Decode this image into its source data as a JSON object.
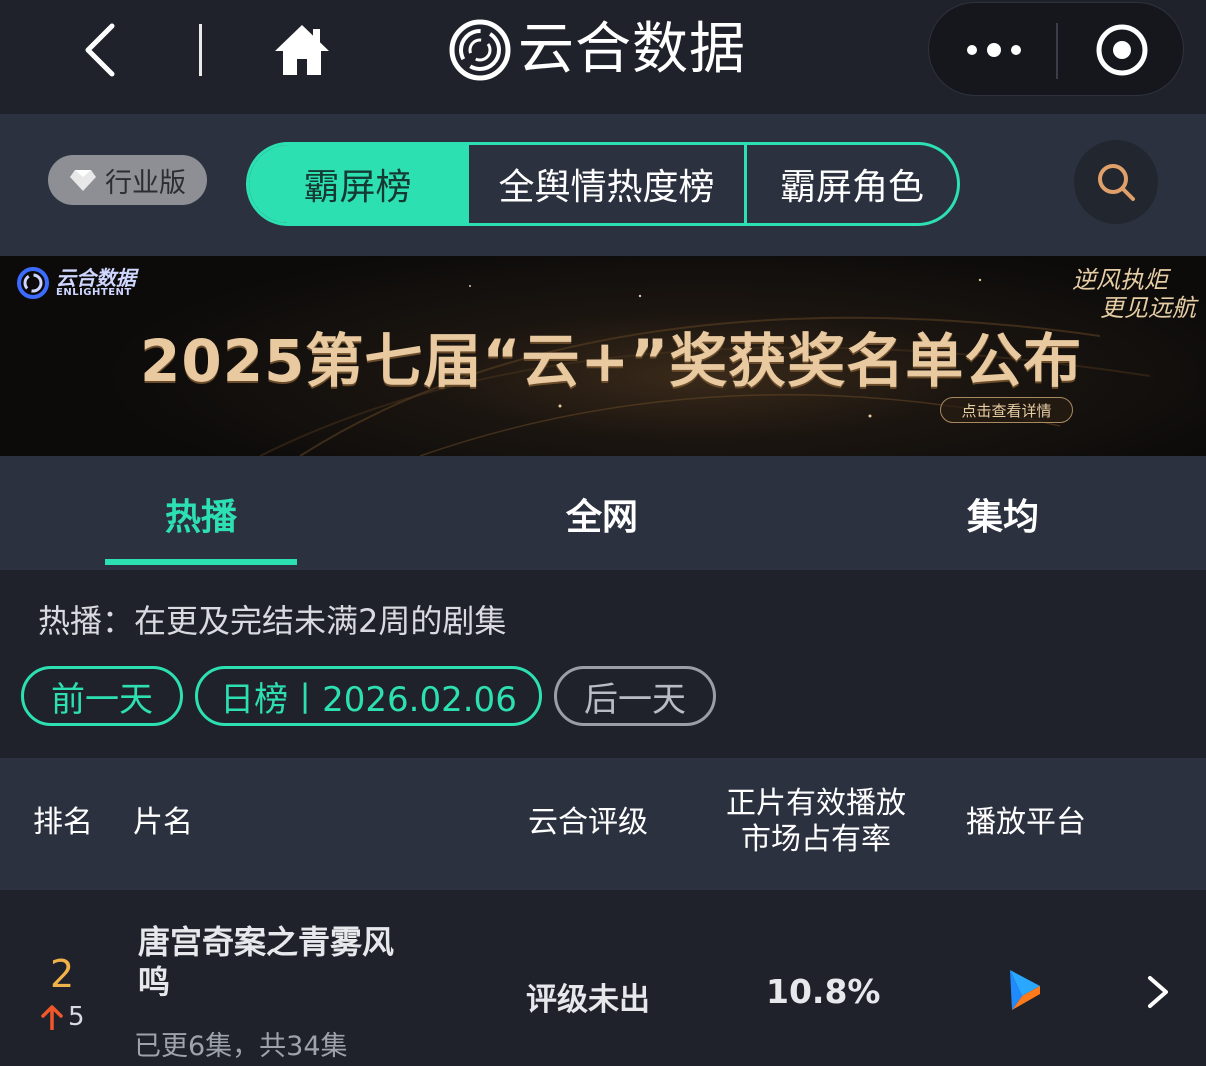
{
  "nav": {
    "back_icon": "chevron-left-icon",
    "home_icon": "home-icon",
    "app_title": "云合数据",
    "more_icon": "more-dots-icon",
    "close_icon": "target-circle-icon"
  },
  "toolbar": {
    "edition_label": "行业版",
    "tabs": [
      {
        "label": "霸屏榜",
        "active": true
      },
      {
        "label": "全舆情热度榜",
        "active": false
      },
      {
        "label": "霸屏角色",
        "active": false
      }
    ],
    "search_icon": "search-icon"
  },
  "banner": {
    "logo_cn": "云合数据",
    "logo_en": "ENLIGHTENT",
    "title": "2025第七届“云+”奖获奖名单公布",
    "slogan_line1": "逆风执炬",
    "slogan_line2": "更见远航",
    "cta": "点击查看详情"
  },
  "subtabs": [
    {
      "label": "热播",
      "active": true
    },
    {
      "label": "全网",
      "active": false
    },
    {
      "label": "集均",
      "active": false
    }
  ],
  "info": {
    "description": "热播：在更及完结未满2周的剧集",
    "prev_day": "前一天",
    "date_label": "日榜丨2026.02.06",
    "next_day": "后一天"
  },
  "table": {
    "headers": {
      "rank": "排名",
      "title": "片名",
      "rating": "云合评级",
      "share_line1": "正片有效播放",
      "share_line2": "市场占有率",
      "platform": "播放平台"
    },
    "rows": [
      {
        "rank": "2",
        "rank_change": "5",
        "rank_direction": "up",
        "title": "唐宫奇案之青雾风鸣",
        "episodes": "已更6集，共34集",
        "rating": "评级未出",
        "share": "10.8%",
        "platform_icon": "youku-play-icon"
      }
    ]
  },
  "colors": {
    "accent": "#2de0b2",
    "background": "#1f222b",
    "panel": "#2c3140",
    "rank": "#f2b24a",
    "rank_up": "#f0582a"
  }
}
